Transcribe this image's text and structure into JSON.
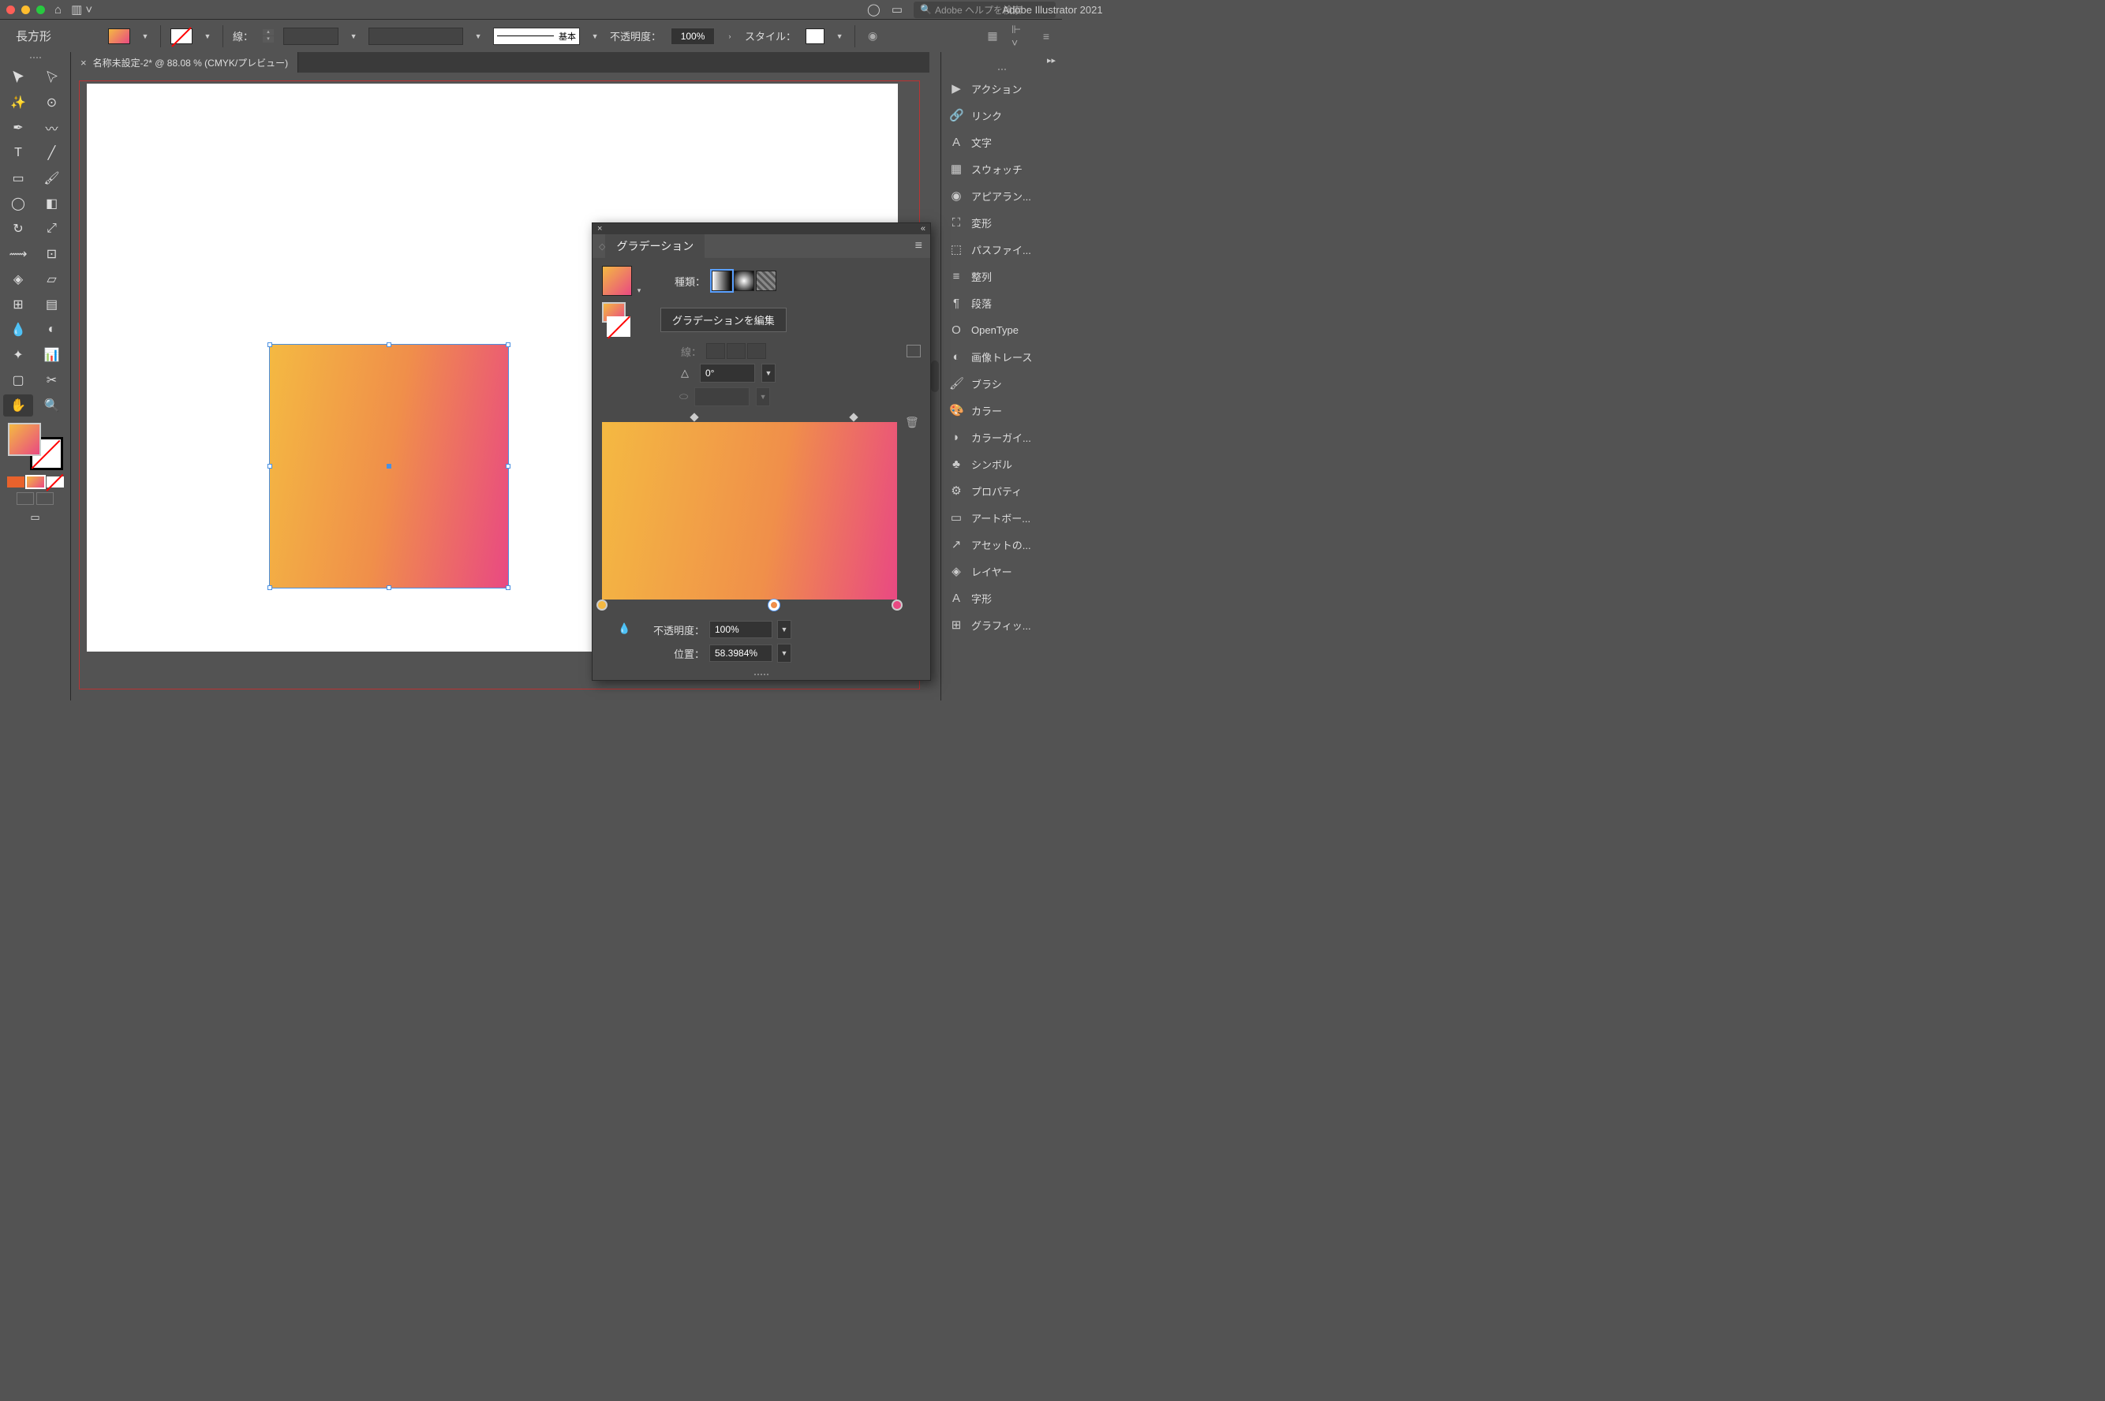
{
  "macbar": {
    "title": "Adobe Illustrator 2021",
    "search_placeholder": "Adobe ヘルプを検索"
  },
  "controlbar": {
    "shape": "長方形",
    "stroke_label": "線：",
    "brush_label": "基本",
    "opacity_label": "不透明度：",
    "opacity_value": "100%",
    "style_label": "スタイル："
  },
  "document": {
    "tab": "名称未設定-2* @ 88.08 % (CMYK/プレビュー)"
  },
  "gradient_panel": {
    "title": "グラデーション",
    "type_label": "種類：",
    "edit_btn": "グラデーションを編集",
    "stroke_label": "線：",
    "angle_value": "0°",
    "opacity_label": "不透明度：",
    "opacity_value": "100%",
    "location_label": "位置：",
    "location_value": "58.3984%",
    "stops": [
      {
        "pos": 0,
        "color": "#f4b942"
      },
      {
        "pos": 58.4,
        "color": "#f08f4a",
        "selected": true
      },
      {
        "pos": 100,
        "color": "#e94982"
      }
    ],
    "opacity_diamonds": [
      29,
      79
    ]
  },
  "right_panels": [
    {
      "icon": "▶",
      "label": "アクション"
    },
    {
      "icon": "🔗",
      "label": "リンク"
    },
    {
      "icon": "A",
      "label": "文字"
    },
    {
      "icon": "▦",
      "label": "スウォッチ"
    },
    {
      "icon": "◉",
      "label": "アピアラン..."
    },
    {
      "icon": "⛶",
      "label": "変形"
    },
    {
      "icon": "⬚",
      "label": "パスファイ..."
    },
    {
      "icon": "≡",
      "label": "整列"
    },
    {
      "icon": "¶",
      "label": "段落"
    },
    {
      "icon": "O",
      "label": "OpenType"
    },
    {
      "icon": "◐",
      "label": "画像トレース"
    },
    {
      "icon": "🖌",
      "label": "ブラシ"
    },
    {
      "icon": "🎨",
      "label": "カラー"
    },
    {
      "icon": "◗",
      "label": "カラーガイ..."
    },
    {
      "icon": "♣",
      "label": "シンボル"
    },
    {
      "icon": "⚙",
      "label": "プロパティ"
    },
    {
      "icon": "▭",
      "label": "アートボー..."
    },
    {
      "icon": "↗",
      "label": "アセットの..."
    },
    {
      "icon": "◈",
      "label": "レイヤー"
    },
    {
      "icon": "A",
      "label": "字形"
    },
    {
      "icon": "⊞",
      "label": "グラフィッ..."
    }
  ],
  "chart_data": {
    "type": "gradient",
    "angle": 0,
    "stops": [
      {
        "position": 0,
        "color": "#f4b942",
        "opacity": 100
      },
      {
        "position": 58.3984,
        "color": "#f08f4a",
        "opacity": 100
      },
      {
        "position": 100,
        "color": "#e94982",
        "opacity": 100
      }
    ]
  }
}
